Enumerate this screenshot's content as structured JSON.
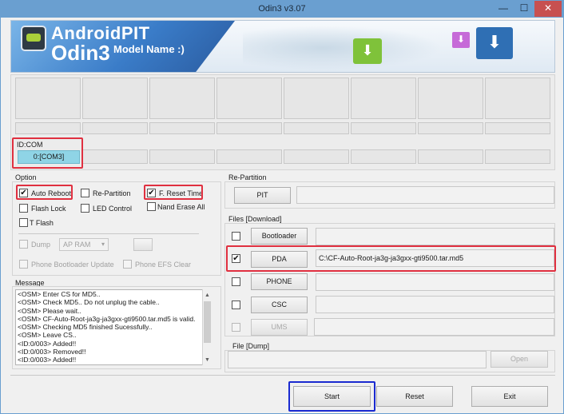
{
  "window": {
    "title": "Odin3 v3.07",
    "minimize": "—",
    "maximize": "☐",
    "close": "✕"
  },
  "banner": {
    "brand": "AndroidPIT",
    "product": "Odin3",
    "model_label": "Model Name :)"
  },
  "ports": {
    "id_com_label": "ID:COM",
    "active_port": "0:[COM3]"
  },
  "option": {
    "title": "Option",
    "auto_reboot": {
      "label": "Auto Reboot",
      "checked": true
    },
    "re_partition": {
      "label": "Re-Partition",
      "checked": false
    },
    "f_reset_time": {
      "label": "F. Reset Time",
      "checked": true
    },
    "flash_lock": {
      "label": "Flash Lock",
      "checked": false
    },
    "led_control": {
      "label": "LED Control",
      "checked": false
    },
    "nand_erase_all": {
      "label": "Nand Erase All",
      "checked": false
    },
    "t_flash": {
      "label": "T Flash",
      "checked": false
    },
    "dump": {
      "label": "Dump",
      "checked": false
    },
    "dump_target": "AP RAM",
    "phone_bootloader_update": {
      "label": "Phone Bootloader Update",
      "checked": false
    },
    "phone_efs_clear": {
      "label": "Phone EFS Clear",
      "checked": false
    }
  },
  "message": {
    "title": "Message",
    "lines": [
      "<OSM> Enter CS for MD5..",
      "<OSM> Check MD5.. Do not unplug the cable..",
      "<OSM> Please wait..",
      "<OSM> CF-Auto-Root-ja3g-ja3gxx-gti9500.tar.md5 is valid.",
      "<OSM> Checking MD5 finished Sucessfully..",
      "<OSM> Leave CS..",
      "<ID:0/003> Added!!",
      "<ID:0/003> Removed!!",
      "<ID:0/003> Added!!"
    ]
  },
  "repartition": {
    "title": "Re-Partition",
    "pit_button": "PIT",
    "pit_path": ""
  },
  "files": {
    "title": "Files [Download]",
    "bootloader": {
      "button": "Bootloader",
      "checked": false,
      "path": ""
    },
    "pda": {
      "button": "PDA",
      "checked": true,
      "path": "C:\\CF-Auto-Root-ja3g-ja3gxx-gti9500.tar.md5"
    },
    "phone": {
      "button": "PHONE",
      "checked": false,
      "path": ""
    },
    "csc": {
      "button": "CSC",
      "checked": false,
      "path": ""
    },
    "ums": {
      "button": "UMS",
      "checked": false,
      "path": ""
    }
  },
  "dump_file": {
    "title": "File [Dump]",
    "open_button": "Open"
  },
  "actions": {
    "start": "Start",
    "reset": "Reset",
    "exit": "Exit"
  },
  "icons": {
    "checkmark": "✔",
    "dropdown": "▾",
    "scroll_up": "▲",
    "scroll_down": "▼",
    "download": "⬇"
  }
}
